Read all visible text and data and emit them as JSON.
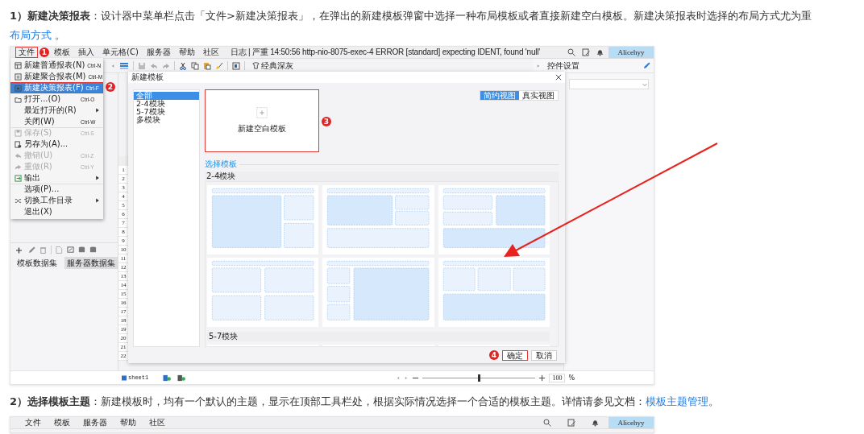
{
  "paragraphs": [
    {
      "text": "**1）新建决策报表**：设计器中菜单栏点击「文件>新建决策报表」，在弹出的新建模板弹窗中选择一种布局模板或者直接新建空白模板。新建决策报表时选择的布局方式尤为重",
      "link": "布局方式",
      "tail": " 。"
    },
    {
      "text": "**2）选择模板主题**：新建模板时，均有一个默认的主题，显示在顶部工具栏处，根据实际情况选择一个合适的模板主题。详情请参见文档：",
      "link": "模板主题管理",
      "tail": "。"
    }
  ],
  "app1": {
    "menubar": [
      {
        "label": "文件",
        "highlighted": true,
        "marker": "1"
      },
      {
        "label": "模板",
        "highlighted": false
      },
      {
        "label": "插入",
        "highlighted": false
      },
      {
        "label": "单元格(C)",
        "highlighted": false
      },
      {
        "label": "服务器",
        "highlighted": false
      },
      {
        "label": "帮助",
        "highlighted": false
      },
      {
        "label": "社区",
        "highlighted": false
      }
    ],
    "log": "日志 | 严重 14:50:56 http-nio-8075-exec-4 ERROR [standard] expecting IDENT, found 'null'",
    "user": "Alicehyy",
    "theme_button": "经典深灰",
    "file_menu": [
      {
        "label": "新建普通报表(N)",
        "shortcut": "Ctrl-N",
        "disabled": false,
        "selected": false,
        "highlighted": false,
        "submenu": false,
        "separator_above": false
      },
      {
        "label": "新建聚合报表(M)",
        "shortcut": "Ctrl-M",
        "disabled": false,
        "selected": false,
        "highlighted": false,
        "submenu": false,
        "separator_above": false
      },
      {
        "label": "新建决策报表(F)",
        "shortcut": "Ctrl-F",
        "disabled": false,
        "selected": true,
        "highlighted": true,
        "submenu": false,
        "separator_above": false,
        "marker": "2"
      },
      {
        "label": "打开...(O)",
        "shortcut": "Ctrl-O",
        "disabled": false,
        "selected": false,
        "highlighted": false,
        "submenu": false,
        "separator_above": false
      },
      {
        "label": "最近打开的(R)",
        "disabled": false,
        "selected": false,
        "highlighted": false,
        "submenu": true,
        "separator_above": false
      },
      {
        "label": "关闭(W)",
        "shortcut": "Ctrl-W",
        "disabled": false,
        "selected": false,
        "highlighted": false,
        "submenu": false,
        "separator_above": false
      },
      {
        "label": "保存(S)",
        "shortcut": "Ctrl-S",
        "disabled": true,
        "selected": false,
        "highlighted": false,
        "submenu": false,
        "separator_above": true
      },
      {
        "label": "另存为(A)...",
        "disabled": false,
        "selected": false,
        "highlighted": false,
        "submenu": false,
        "separator_above": false
      },
      {
        "label": "撤销(U)",
        "shortcut": "Ctrl-Z",
        "disabled": true,
        "selected": false,
        "highlighted": false,
        "submenu": false,
        "separator_above": false
      },
      {
        "label": "重做(R)",
        "shortcut": "Ctrl-Y",
        "disabled": true,
        "selected": false,
        "highlighted": false,
        "submenu": false,
        "separator_above": false
      },
      {
        "label": "输出",
        "disabled": false,
        "selected": false,
        "highlighted": false,
        "submenu": true,
        "separator_above": false
      },
      {
        "label": "选项(P)...",
        "disabled": false,
        "selected": false,
        "highlighted": false,
        "submenu": false,
        "separator_above": true
      },
      {
        "label": "切换工作目录",
        "disabled": false,
        "selected": false,
        "highlighted": false,
        "submenu": true,
        "separator_above": false
      },
      {
        "label": "退出(X)",
        "disabled": false,
        "selected": false,
        "highlighted": false,
        "submenu": false,
        "separator_above": false
      }
    ],
    "data_tabs": [
      {
        "label": "模板数据集",
        "selected": false
      },
      {
        "label": "服务器数据集",
        "selected": true
      }
    ],
    "right_panel": {
      "title": "控件设置"
    },
    "row_numbers": [
      "1",
      "2",
      "3",
      "4",
      "5",
      "6",
      "7",
      "8",
      "9",
      "10",
      "11",
      "12",
      "13",
      "14",
      "15",
      "16",
      "17",
      "18",
      "19",
      "20",
      "21",
      "22"
    ],
    "sheet_tab": "sheet1",
    "zoom": {
      "level": 0.5,
      "value": "100",
      "unit": "%"
    },
    "dialog": {
      "title": "新建模板",
      "categories": [
        {
          "label": "全部",
          "selected": true
        },
        {
          "label": "2-4模块",
          "selected": false
        },
        {
          "label": "5-7模块",
          "selected": false
        },
        {
          "label": "多模块",
          "selected": false
        }
      ],
      "blank_template": {
        "label": "新建空白模板",
        "highlighted": true,
        "marker": "3"
      },
      "views": [
        {
          "label": "简约视图",
          "selected": true
        },
        {
          "label": "真实视图",
          "selected": false
        }
      ],
      "section": "选择模板",
      "groups": [
        {
          "title": "2-4模块"
        },
        {
          "title": "5-7模块"
        }
      ],
      "buttons": [
        {
          "label": "确定",
          "highlighted": true,
          "marker": "4"
        },
        {
          "label": "取消",
          "highlighted": false
        }
      ]
    }
  },
  "app2": {
    "menubar": [
      {
        "label": "文件",
        "highlighted": false
      },
      {
        "label": "模板",
        "highlighted": false
      },
      {
        "label": "服务器",
        "highlighted": false
      },
      {
        "label": "帮助",
        "highlighted": false
      },
      {
        "label": "社区",
        "highlighted": false
      }
    ],
    "user": "Alicehyy"
  }
}
